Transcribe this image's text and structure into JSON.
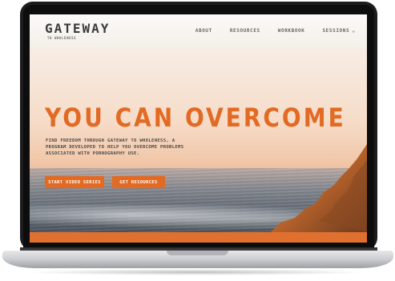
{
  "brand": {
    "name": "GATEWAY",
    "tagline": "TO WHOLENESS"
  },
  "nav": {
    "items": [
      {
        "label": "ABOUT"
      },
      {
        "label": "RESOURCES"
      },
      {
        "label": "WORKBOOK"
      },
      {
        "label": "SESSIONS"
      }
    ]
  },
  "hero": {
    "headline": "YOU CAN OVERCOME",
    "sub_lines": [
      "FIND FREEDOM THROUGH GATEWAY TO WHOLENESS, A",
      "PROGRAM DEVELOPED TO HELP YOU OVERCOME PROBLEMS",
      "ASSOCIATED WITH PORNOGRAPHY USE."
    ],
    "primary_button": "START VIDEO SERIES",
    "secondary_button": "GET RESOURCES"
  },
  "colors": {
    "accent": "#E36A23",
    "nav_text": "#6A6663",
    "logo": "#3B3B3B"
  }
}
